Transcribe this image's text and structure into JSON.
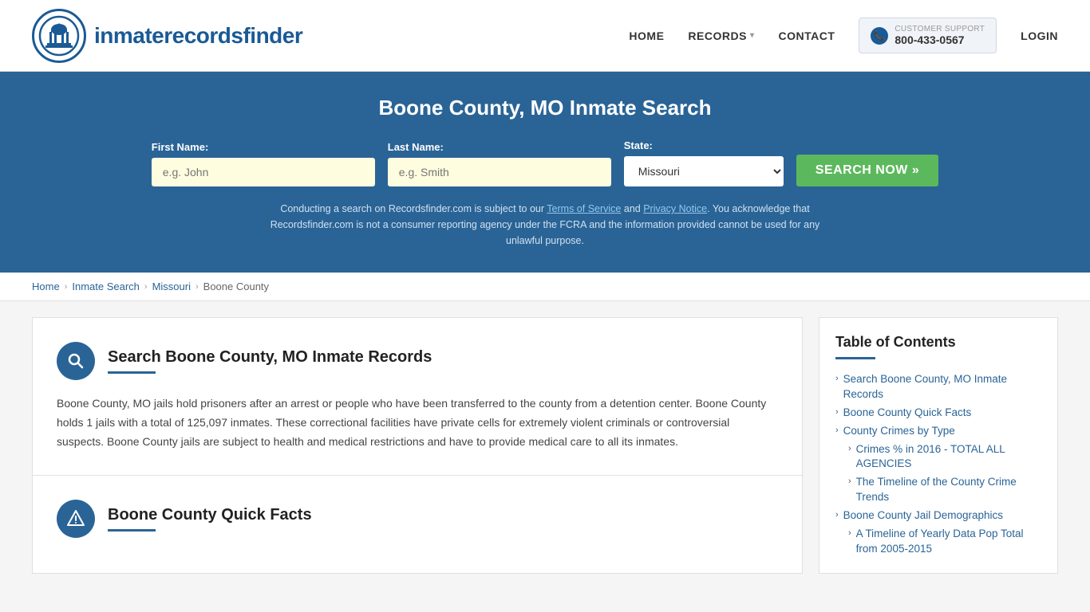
{
  "header": {
    "logo_text_regular": "inmaterecords",
    "logo_text_bold": "finder",
    "nav": {
      "home": "HOME",
      "records": "RECORDS",
      "contact": "CONTACT",
      "customer_support_label": "CUSTOMER SUPPORT",
      "customer_support_number": "800-433-0567",
      "login": "LOGIN"
    }
  },
  "hero": {
    "title": "Boone County, MO Inmate Search",
    "first_name_label": "First Name:",
    "first_name_placeholder": "e.g. John",
    "last_name_label": "Last Name:",
    "last_name_placeholder": "e.g. Smith",
    "state_label": "State:",
    "state_value": "Missouri",
    "search_button": "SEARCH NOW »",
    "disclaimer": "Conducting a search on Recordsfinder.com is subject to our Terms of Service and Privacy Notice. You acknowledge that Recordsfinder.com is not a consumer reporting agency under the FCRA and the information provided cannot be used for any unlawful purpose.",
    "terms_link": "Terms of Service",
    "privacy_link": "Privacy Notice"
  },
  "breadcrumb": {
    "home": "Home",
    "inmate_search": "Inmate Search",
    "state": "Missouri",
    "county": "Boone County"
  },
  "main": {
    "section1": {
      "title": "Search Boone County, MO Inmate Records",
      "body": "Boone County, MO jails hold prisoners after an arrest or people who have been transferred to the county from a detention center. Boone County holds 1 jails with a total of 125,097 inmates. These correctional facilities have private cells for extremely violent criminals or controversial suspects. Boone County jails are subject to health and medical restrictions and have to provide medical care to all its inmates."
    },
    "section2": {
      "title": "Boone County Quick Facts"
    }
  },
  "toc": {
    "title": "Table of Contents",
    "items": [
      {
        "label": "Search Boone County, MO Inmate Records",
        "sub": false
      },
      {
        "label": "Boone County Quick Facts",
        "sub": false
      },
      {
        "label": "County Crimes by Type",
        "sub": false
      },
      {
        "label": "Crimes % in 2016 - TOTAL ALL AGENCIES",
        "sub": true
      },
      {
        "label": "The Timeline of the County Crime Trends",
        "sub": true
      },
      {
        "label": "Boone County Jail Demographics",
        "sub": false
      },
      {
        "label": "A Timeline of Yearly Data Pop Total from 2005-2015",
        "sub": true
      }
    ]
  }
}
